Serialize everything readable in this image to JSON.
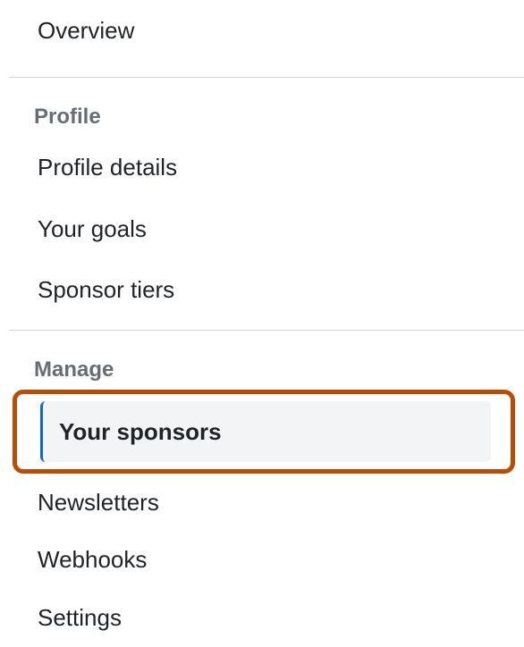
{
  "sidebar": {
    "overview": "Overview",
    "sections": [
      {
        "header": "Profile",
        "items": [
          {
            "label": "Profile details"
          },
          {
            "label": "Your goals"
          },
          {
            "label": "Sponsor tiers"
          }
        ]
      },
      {
        "header": "Manage",
        "items": [
          {
            "label": "Your sponsors",
            "active": true
          },
          {
            "label": "Newsletters"
          },
          {
            "label": "Webhooks"
          },
          {
            "label": "Settings"
          }
        ]
      }
    ]
  }
}
